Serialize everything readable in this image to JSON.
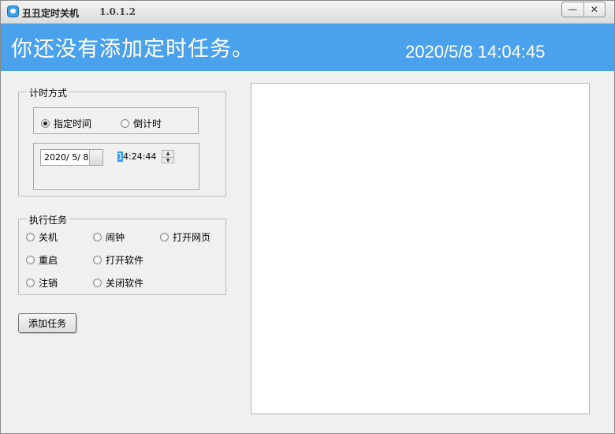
{
  "window": {
    "title": "丑丑定时关机",
    "version": "1.0.1.2",
    "minimize_glyph": "—",
    "close_glyph": "✕"
  },
  "banner": {
    "message": "你还没有添加定时任务。",
    "clock": "2020/5/8 14:04:45",
    "color": "#4aa1ec"
  },
  "timing": {
    "legend": "计时方式",
    "options": [
      {
        "label": "指定时间",
        "selected": true
      },
      {
        "label": "倒计时",
        "selected": false
      }
    ],
    "date_value": "2020/ 5/ 8",
    "time_selected_part": "1",
    "time_rest": "4:24:44"
  },
  "tasks": {
    "legend": "执行任务",
    "options": [
      "关机",
      "闹钟",
      "打开网页",
      "重启",
      "打开软件",
      "注销",
      "关闭软件"
    ]
  },
  "add_button_label": "添加任务",
  "task_list": {
    "items": []
  }
}
